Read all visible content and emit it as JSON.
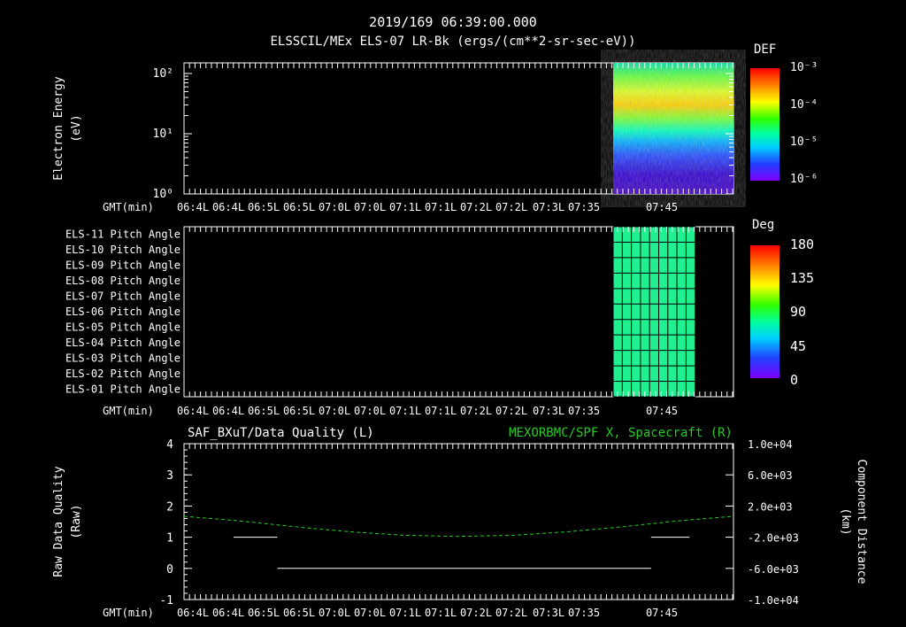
{
  "header": {
    "timestamp": "2019/169 06:39:00.000",
    "title": "ELSSCIL/MEx ELS-07 LR-Bk  (ergs/(cm**2-sr-sec-eV))"
  },
  "colors": {
    "background": "#000000",
    "axis": "#ffffff",
    "right_series": "#22cc22"
  },
  "time_axis": {
    "label": "GMT(min)",
    "ticks": [
      "06:4L",
      "06:4L",
      "06:5L",
      "06:5L",
      "07:0L",
      "07:0L",
      "07:1L",
      "07:1L",
      "07:2L",
      "07:2L",
      "07:3L",
      "07:35",
      "07:45"
    ]
  },
  "chart_data": [
    {
      "type": "heatmap",
      "ylabel": "Electron Energy (eV)",
      "yscale": "log",
      "ylim": [
        1,
        150
      ],
      "yticks": [
        "10²",
        "10¹",
        "10⁰"
      ],
      "colorbar": {
        "label": "DEF",
        "ticks": [
          "10⁻³",
          "10⁻⁴",
          "10⁻⁵",
          "10⁻⁶"
        ]
      },
      "data_start_minute": 7.615
    },
    {
      "type": "heatmap",
      "ylabel_rows": [
        "ELS-11 Pitch Angle",
        "ELS-10 Pitch Angle",
        "ELS-09 Pitch Angle",
        "ELS-08 Pitch Angle",
        "ELS-07 Pitch Angle",
        "ELS-06 Pitch Angle",
        "ELS-05 Pitch Angle",
        "ELS-04 Pitch Angle",
        "ELS-03 Pitch Angle",
        "ELS-02 Pitch Angle",
        "ELS-01 Pitch Angle"
      ],
      "colorbar": {
        "label": "Deg",
        "ticks": [
          "180",
          "135",
          "90",
          "45",
          "0"
        ],
        "range": [
          0,
          180
        ]
      },
      "value_deg": 90
    },
    {
      "type": "line",
      "title_left": "SAF_BXuT/Data Quality (L)",
      "title_right": "MEXORBMC/SPF X, Spacecraft (R)",
      "ylabel_left": "Raw Data Quality (Raw)",
      "ylabel_right": "Component Distance (km)",
      "ylim_left": [
        -1,
        4
      ],
      "yticks_left": [
        "4",
        "3",
        "2",
        "1",
        "0",
        "-1"
      ],
      "ylim_right": [
        -10000,
        10000
      ],
      "yticks_right": [
        "1.0e+04",
        "6.0e+03",
        "2.0e+03",
        "-2.0e+03",
        "-6.0e+03",
        "-1.0e+04"
      ],
      "series_left": {
        "name": "SAF_BXuT/Data Quality",
        "segments": [
          {
            "x": [
              0.09,
              0.17
            ],
            "y": [
              1,
              1
            ]
          },
          {
            "x": [
              0.17,
              0.85
            ],
            "y": [
              0,
              0
            ]
          },
          {
            "x": [
              0.85,
              0.92
            ],
            "y": [
              1,
              1
            ]
          }
        ]
      },
      "series_right": {
        "name": "MEXORBMC/SPF X, Spacecraft",
        "x": [
          0.0,
          0.1,
          0.2,
          0.3,
          0.4,
          0.5,
          0.6,
          0.7,
          0.8,
          0.9,
          1.0
        ],
        "y": [
          680,
          100,
          -650,
          -1300,
          -1750,
          -1900,
          -1750,
          -1300,
          -650,
          100,
          680
        ]
      }
    }
  ]
}
